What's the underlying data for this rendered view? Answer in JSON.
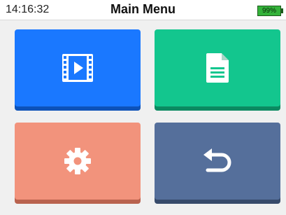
{
  "status_bar": {
    "time": "14:16:32",
    "title": "Main Menu",
    "battery_percent_text": "99%",
    "battery_level": 0.99
  },
  "tiles": [
    {
      "name": "video",
      "icon": "video-film-icon",
      "color": "#1a78ff",
      "shadow": "#0d52b8"
    },
    {
      "name": "documents",
      "icon": "document-icon",
      "color": "#13c68e",
      "shadow": "#0b8a61"
    },
    {
      "name": "settings",
      "icon": "gear-icon",
      "color": "#f2937c",
      "shadow": "#b9624e"
    },
    {
      "name": "back",
      "icon": "back-arrow-icon",
      "color": "#556f9b",
      "shadow": "#374a6a"
    }
  ]
}
